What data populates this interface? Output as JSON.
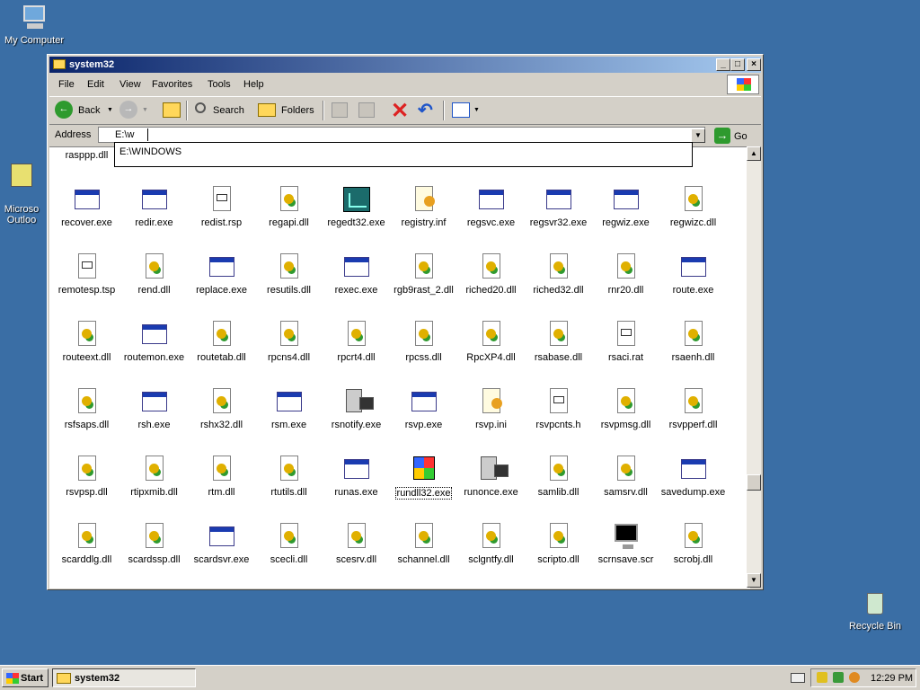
{
  "desktop": {
    "icons": [
      {
        "label": "My Computer"
      },
      {
        "label": "Microso\nOutloo"
      },
      {
        "label": "Recycle Bin"
      }
    ]
  },
  "window": {
    "title": "system32",
    "menu": [
      "File",
      "Edit",
      "View",
      "Favorites",
      "Tools",
      "Help"
    ],
    "toolbar": {
      "back": "Back",
      "search": "Search",
      "folders": "Folders"
    },
    "address": {
      "label": "Address",
      "value": "E:\\w",
      "go_label": "Go",
      "suggestion": "E:\\WINDOWS"
    },
    "files": [
      {
        "name": "rasppp.dll",
        "icon": "dll"
      },
      {
        "name": "recover.exe",
        "icon": "win"
      },
      {
        "name": "redir.exe",
        "icon": "win"
      },
      {
        "name": "redist.rsp",
        "icon": "doc"
      },
      {
        "name": "regapi.dll",
        "icon": "dll"
      },
      {
        "name": "regedt32.exe",
        "icon": "reg"
      },
      {
        "name": "registry.inf",
        "icon": "ini"
      },
      {
        "name": "regsvc.exe",
        "icon": "win"
      },
      {
        "name": "regsvr32.exe",
        "icon": "win"
      },
      {
        "name": "regwiz.exe",
        "icon": "win"
      },
      {
        "name": "regwizc.dll",
        "icon": "dll"
      },
      {
        "name": "remotesp.tsp",
        "icon": "doc"
      },
      {
        "name": "rend.dll",
        "icon": "dll"
      },
      {
        "name": "replace.exe",
        "icon": "win"
      },
      {
        "name": "resutils.dll",
        "icon": "dll"
      },
      {
        "name": "rexec.exe",
        "icon": "win"
      },
      {
        "name": "rgb9rast_2.dll",
        "icon": "dll"
      },
      {
        "name": "riched20.dll",
        "icon": "dll"
      },
      {
        "name": "riched32.dll",
        "icon": "dll"
      },
      {
        "name": "rnr20.dll",
        "icon": "dll"
      },
      {
        "name": "route.exe",
        "icon": "win"
      },
      {
        "name": "routeext.dll",
        "icon": "dll"
      },
      {
        "name": "routemon.exe",
        "icon": "win"
      },
      {
        "name": "routetab.dll",
        "icon": "dll"
      },
      {
        "name": "rpcns4.dll",
        "icon": "dll"
      },
      {
        "name": "rpcrt4.dll",
        "icon": "dll"
      },
      {
        "name": "rpcss.dll",
        "icon": "dll"
      },
      {
        "name": "RpcXP4.dll",
        "icon": "dll"
      },
      {
        "name": "rsabase.dll",
        "icon": "dll"
      },
      {
        "name": "rsaci.rat",
        "icon": "doc"
      },
      {
        "name": "rsaenh.dll",
        "icon": "dll"
      },
      {
        "name": "rsfsaps.dll",
        "icon": "dll"
      },
      {
        "name": "rsh.exe",
        "icon": "win"
      },
      {
        "name": "rshx32.dll",
        "icon": "dll"
      },
      {
        "name": "rsm.exe",
        "icon": "win"
      },
      {
        "name": "rsnotify.exe",
        "icon": "pc"
      },
      {
        "name": "rsvp.exe",
        "icon": "win"
      },
      {
        "name": "rsvp.ini",
        "icon": "ini"
      },
      {
        "name": "rsvpcnts.h",
        "icon": "doc"
      },
      {
        "name": "rsvpmsg.dll",
        "icon": "dll"
      },
      {
        "name": "rsvpperf.dll",
        "icon": "dll"
      },
      {
        "name": "rsvpsp.dll",
        "icon": "dll"
      },
      {
        "name": "rtipxmib.dll",
        "icon": "dll"
      },
      {
        "name": "rtm.dll",
        "icon": "dll"
      },
      {
        "name": "rtutils.dll",
        "icon": "dll"
      },
      {
        "name": "runas.exe",
        "icon": "win"
      },
      {
        "name": "rundll32.exe",
        "icon": "flag",
        "selected": true
      },
      {
        "name": "runonce.exe",
        "icon": "pc"
      },
      {
        "name": "samlib.dll",
        "icon": "dll"
      },
      {
        "name": "samsrv.dll",
        "icon": "dll"
      },
      {
        "name": "savedump.exe",
        "icon": "win"
      },
      {
        "name": "scarddlg.dll",
        "icon": "dll"
      },
      {
        "name": "scardssp.dll",
        "icon": "dll"
      },
      {
        "name": "scardsvr.exe",
        "icon": "win"
      },
      {
        "name": "scecli.dll",
        "icon": "dll"
      },
      {
        "name": "scesrv.dll",
        "icon": "dll"
      },
      {
        "name": "schannel.dll",
        "icon": "dll"
      },
      {
        "name": "sclgntfy.dll",
        "icon": "dll"
      },
      {
        "name": "scripto.dll",
        "icon": "dll"
      },
      {
        "name": "scrnsave.scr",
        "icon": "mon"
      },
      {
        "name": "scrobj.dll",
        "icon": "dll"
      }
    ]
  },
  "taskbar": {
    "start_label": "Start",
    "task_label": "system32",
    "clock": "12:29 PM"
  }
}
